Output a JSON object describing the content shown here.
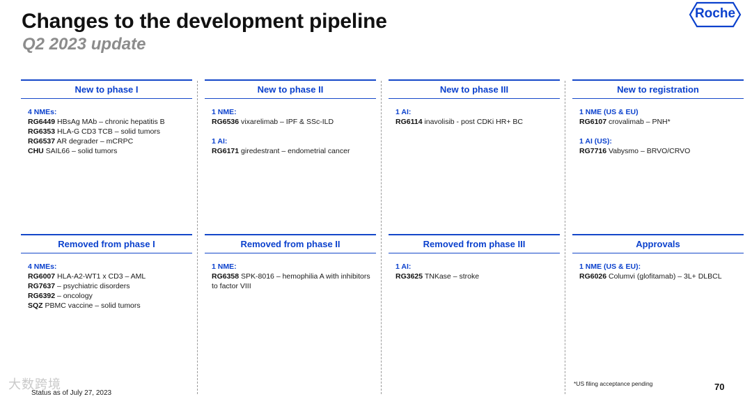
{
  "header": {
    "title": "Changes to the development pipeline",
    "subtitle": "Q2 2023 update",
    "logo_text": "Roche"
  },
  "panels": [
    {
      "title": "New to phase I",
      "groups": [
        {
          "label": "4 NMEs:",
          "items": [
            {
              "code": "RG6449",
              "text": "HBsAg MAb – chronic hepatitis B"
            },
            {
              "code": "RG6353",
              "text": "HLA-G CD3 TCB – solid tumors"
            },
            {
              "code": "RG6537",
              "text": "AR degrader – mCRPC"
            },
            {
              "code": "CHU",
              "text": "SAIL66 – solid tumors"
            }
          ]
        }
      ]
    },
    {
      "title": "New to phase II",
      "groups": [
        {
          "label": "1 NME:",
          "items": [
            {
              "code": "RG6536",
              "text": "vixarelimab – IPF & SSc-ILD"
            }
          ]
        },
        {
          "label": "1 AI:",
          "items": [
            {
              "code": "RG6171",
              "text": "giredestrant – endometrial cancer"
            }
          ]
        }
      ]
    },
    {
      "title": "New to phase III",
      "groups": [
        {
          "label": "1 AI:",
          "items": [
            {
              "code": "RG6114",
              "text": "inavolisib - post CDKi HR+ BC"
            }
          ]
        }
      ]
    },
    {
      "title": "New to registration",
      "groups": [
        {
          "label": "1 NME (US & EU)",
          "items": [
            {
              "code": "RG6107",
              "text": "crovalimab – PNH*"
            }
          ]
        },
        {
          "label": "1 AI (US):",
          "items": [
            {
              "code": "RG7716",
              "text": "Vabysmo – BRVO/CRVO"
            }
          ]
        }
      ]
    },
    {
      "title": "Removed from phase I",
      "groups": [
        {
          "label": "4 NMEs:",
          "items": [
            {
              "code": "RG6007",
              "text": "HLA-A2-WT1 x CD3 – AML"
            },
            {
              "code": "RG7637",
              "text": " – psychiatric disorders"
            },
            {
              "code": "RG6392",
              "text": " – oncology"
            },
            {
              "code": "SQZ",
              "text": "PBMC vaccine – solid tumors"
            }
          ]
        }
      ]
    },
    {
      "title": "Removed from phase II",
      "groups": [
        {
          "label": "1 NME:",
          "items": [
            {
              "code": "RG6358",
              "text": "SPK-8016 – hemophilia A with inhibitors to factor VIII"
            }
          ]
        }
      ]
    },
    {
      "title": "Removed from phase III",
      "groups": [
        {
          "label": "1 AI:",
          "items": [
            {
              "code": "RG3625",
              "text": "TNKase – stroke"
            }
          ]
        }
      ]
    },
    {
      "title": "Approvals",
      "groups": [
        {
          "label": "1 NME (US & EU):",
          "items": [
            {
              "code": "RG6026",
              "text": "Columvi (glofitamab) – 3L+ DLBCL"
            }
          ]
        }
      ]
    }
  ],
  "footer": {
    "footnote": "*US filing acceptance pending",
    "page_number": "70",
    "status": "Status as of July 27, 2023",
    "watermark": "大数跨境"
  },
  "colors": {
    "accent": "#0b41cd",
    "rule": "#1447c9",
    "subtitle": "#8c8c8c"
  }
}
